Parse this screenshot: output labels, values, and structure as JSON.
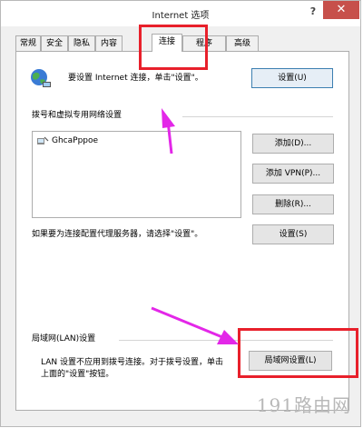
{
  "window": {
    "title": "Internet 选项",
    "help_label": "?",
    "close_label": "✕"
  },
  "tabs": [
    {
      "label": "常规"
    },
    {
      "label": "安全"
    },
    {
      "label": "隐私"
    },
    {
      "label": "内容"
    },
    {
      "label": "连接",
      "active": true
    },
    {
      "label": "程序"
    },
    {
      "label": "高级"
    }
  ],
  "connect_section": {
    "text": "要设置 Internet 连接，单击\"设置\"。",
    "setup_button": "设置(U)",
    "icon": "globe-network-icon"
  },
  "dialup_section": {
    "heading": "拨号和虚拟专用网络设置",
    "connections": [
      {
        "name": "GhcaPppoe",
        "icon": "dialup-connection-icon"
      }
    ],
    "add_button": "添加(D)...",
    "add_vpn_button": "添加 VPN(P)...",
    "remove_button": "删除(R)...",
    "proxy_note": "如果要为连接配置代理服务器，请选择\"设置\"。",
    "settings_button": "设置(S)"
  },
  "lan_section": {
    "heading": "局域网(LAN)设置",
    "description_line1": "LAN 设置不应用到拨号连接。对于拨号设置，单击",
    "description_line2": "上面的\"设置\"按钮。",
    "lan_settings_button": "局域网设置(L)"
  },
  "annotations": {
    "highlight_color": "#e8202b",
    "arrow_color": "#e327e8"
  },
  "watermark": "191路由网"
}
